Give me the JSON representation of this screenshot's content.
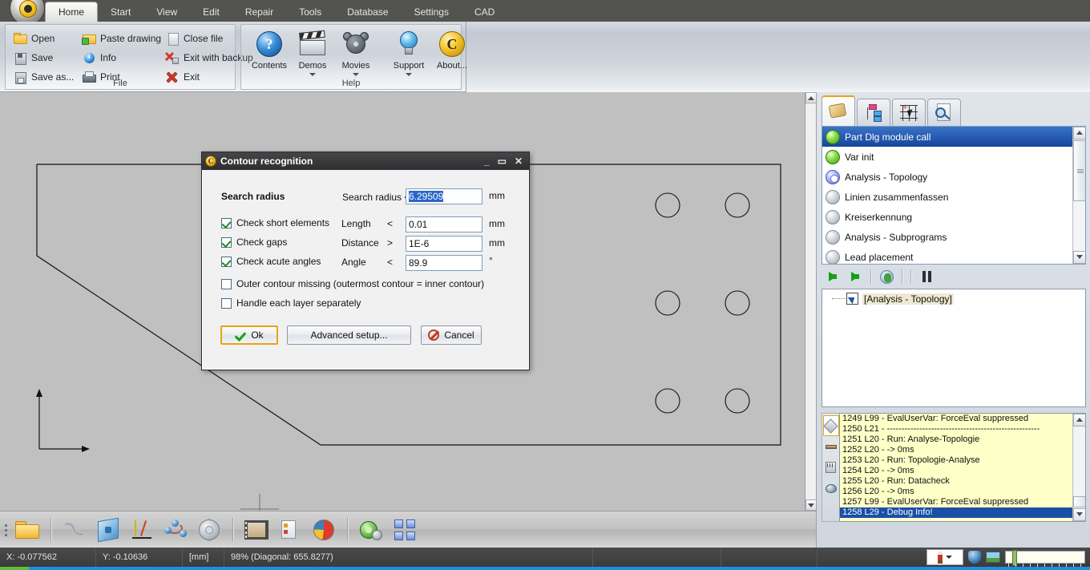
{
  "ribbon": {
    "app_button_name": "application-menu-button",
    "tabs": [
      {
        "label": "Home",
        "active": true
      },
      {
        "label": "Start",
        "active": false
      },
      {
        "label": "View",
        "active": false
      },
      {
        "label": "Edit",
        "active": false
      },
      {
        "label": "Repair",
        "active": false
      },
      {
        "label": "Tools",
        "active": false
      },
      {
        "label": "Database",
        "active": false
      },
      {
        "label": "Settings",
        "active": false
      },
      {
        "label": "CAD",
        "active": false
      }
    ],
    "groups": [
      {
        "label": "File",
        "columns": [
          [
            {
              "label": "Open",
              "icon": "folder-icon"
            },
            {
              "label": "Save",
              "icon": "floppy-icon"
            },
            {
              "label": "Save as...",
              "icon": "floppy-as-icon"
            }
          ],
          [
            {
              "label": "Paste drawing",
              "icon": "paste-drawing-icon"
            },
            {
              "label": "Info",
              "icon": "info-icon"
            },
            {
              "label": "Print",
              "icon": "printer-icon"
            }
          ],
          [
            {
              "label": "Close file",
              "icon": "close-file-icon"
            },
            {
              "label": "Exit with backup",
              "icon": "exit-backup-icon"
            },
            {
              "label": "Exit",
              "icon": "exit-icon"
            }
          ]
        ]
      },
      {
        "label": "Help",
        "items": [
          {
            "label": "Contents",
            "icon": "help-question-icon",
            "dropdown": false
          },
          {
            "label": "Demos",
            "icon": "clapperboard-icon",
            "dropdown": true
          },
          {
            "label": "Movies",
            "icon": "film-reel-icon",
            "dropdown": true
          },
          {
            "label": "Support",
            "icon": "lightbulb-icon",
            "dropdown": true
          },
          {
            "label": "About...",
            "icon": "about-c-icon",
            "dropdown": false
          }
        ]
      }
    ]
  },
  "dialog": {
    "title": "Contour recognition",
    "window_buttons": {
      "minimize": "_",
      "maximize": "▭",
      "close": "✕"
    },
    "section_title": "Search radius",
    "search_radius": {
      "label": "Search radius <=",
      "value": "6.29509",
      "unit": "mm",
      "selected": true
    },
    "rows": [
      {
        "checkbox_label": "Check short elements",
        "checked": true,
        "field_label": "Length",
        "operator": "<",
        "value": "0.01",
        "unit": "mm"
      },
      {
        "checkbox_label": "Check gaps",
        "checked": true,
        "field_label": "Distance",
        "operator": ">",
        "value": "1E-6",
        "unit": "mm"
      },
      {
        "checkbox_label": "Check acute angles",
        "checked": true,
        "field_label": "Angle",
        "operator": "<",
        "value": "89.9",
        "unit": "°"
      }
    ],
    "extra_checkboxes": [
      {
        "label": "Outer contour missing (outermost contour = inner contour)",
        "checked": false
      },
      {
        "label": "Handle each layer separately",
        "checked": false
      }
    ],
    "buttons": [
      {
        "label": "Ok",
        "icon": "check-icon",
        "default": true
      },
      {
        "label": "Advanced setup...",
        "icon": "",
        "default": false
      },
      {
        "label": "Cancel",
        "icon": "deny-icon",
        "default": false
      }
    ]
  },
  "right_panel": {
    "tabs": [
      {
        "name": "scroll-tab",
        "icon": "scroll-icon",
        "active": true
      },
      {
        "name": "tree-tab",
        "icon": "tree-structure-icon",
        "active": false
      },
      {
        "name": "grid-tab",
        "icon": "grid-pointer-icon",
        "active": false
      },
      {
        "name": "preview-tab",
        "icon": "document-magnifier-icon",
        "active": false
      }
    ],
    "module_list": [
      {
        "label": "Part Dlg module call",
        "status": "green",
        "selected": true
      },
      {
        "label": "Var init",
        "status": "green",
        "selected": false
      },
      {
        "label": "Analysis - Topology",
        "status": "gear",
        "selected": false
      },
      {
        "label": "Linien zusammenfassen",
        "status": "gray",
        "selected": false
      },
      {
        "label": "Kreiserkennung",
        "status": "gray",
        "selected": false
      },
      {
        "label": "Analysis - Subprograms",
        "status": "gray",
        "selected": false
      },
      {
        "label": "Lead placement",
        "status": "gray",
        "selected": false
      }
    ],
    "run_toolbar": [
      {
        "name": "run-button",
        "icon": "green-arrow-icon"
      },
      {
        "name": "step-button",
        "icon": "green-arrow-icon"
      },
      {
        "name": "refresh-button",
        "icon": "globe-refresh-icon"
      },
      {
        "name": "pause-button",
        "icon": "pause-icon"
      }
    ],
    "tree": [
      {
        "label": "[Analysis - Topology]",
        "icon": "shortcut-arrow-icon"
      }
    ],
    "log_side_buttons": [
      {
        "name": "log-filter-diamond",
        "icon": "diamond-icon",
        "selected": true
      },
      {
        "name": "log-filter-bar",
        "icon": "bar-icon",
        "selected": false
      },
      {
        "name": "log-filter-calc",
        "icon": "calculator-icon",
        "selected": false
      },
      {
        "name": "log-filter-ball",
        "icon": "sphere-icon",
        "selected": false
      }
    ],
    "log_lines": [
      {
        "text": "1249 L99 - EvalUserVar: ForceEval suppressed",
        "selected": false
      },
      {
        "text": "1250 L21 - ----------------------------------------------------",
        "selected": false
      },
      {
        "text": "1251 L20 - Run: Analyse-Topologie",
        "selected": false
      },
      {
        "text": "1252 L20 -  -> 0ms",
        "selected": false
      },
      {
        "text": "1253 L20 - Run: Topologie-Analyse",
        "selected": false
      },
      {
        "text": "1254 L20 -  -> 0ms",
        "selected": false
      },
      {
        "text": "1255 L20 - Run: Datacheck",
        "selected": false
      },
      {
        "text": "1256 L20 -  -> 0ms",
        "selected": false
      },
      {
        "text": "1257 L99 - EvalUserVar: ForceEval suppressed",
        "selected": false
      },
      {
        "text": "1258 L29 - Debug Info!",
        "selected": true
      }
    ]
  },
  "bottom_toolbar": [
    {
      "name": "open-file-tool",
      "icon": "folder-icon"
    },
    {
      "name": "chain-tool",
      "icon": "chain-icon"
    },
    {
      "name": "solid-tool",
      "icon": "blue-cube-icon"
    },
    {
      "name": "axis-tool",
      "icon": "axis-icon"
    },
    {
      "name": "spline-tool",
      "icon": "spline-nodes-icon"
    },
    {
      "name": "settings-tool",
      "icon": "gear-icon"
    },
    {
      "name": "film-tool",
      "icon": "film-strip-icon"
    },
    {
      "name": "report-tool",
      "icon": "document-icon"
    },
    {
      "name": "chart-tool",
      "icon": "pie-chart-icon"
    },
    {
      "name": "nest-tool",
      "icon": "green-gear-icon"
    },
    {
      "name": "layout-tool",
      "icon": "blue-layout-icon"
    }
  ],
  "status_bar": {
    "x": "X: -0.077562",
    "y": "Y: -0.10636",
    "unit": "[mm]",
    "zoom": "98% (Diagonal: 655.8277)",
    "right_tools": [
      {
        "name": "pen-color-picker",
        "icon": "pencil-icon"
      },
      {
        "name": "shield-status",
        "icon": "shield-icon"
      },
      {
        "name": "image-status",
        "icon": "image-icon"
      },
      {
        "name": "zoom-slider",
        "icon": "slider-icon"
      }
    ]
  },
  "canvas": {
    "name": "cad-drawing-area",
    "background_color": "#c0c0c0",
    "origin_marker": "coordinate-axis-marker"
  }
}
